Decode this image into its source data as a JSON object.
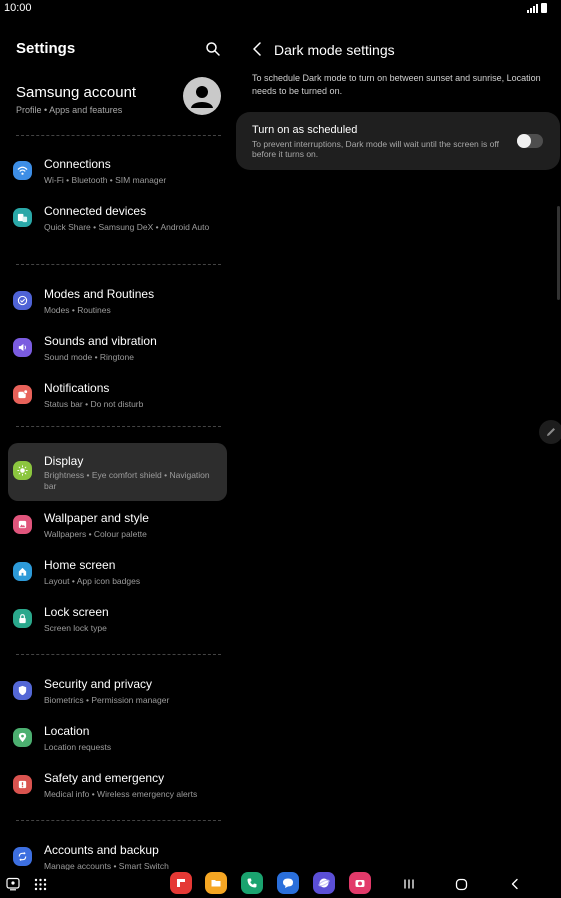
{
  "status": {
    "time": "10:00"
  },
  "left": {
    "title": "Settings",
    "account": {
      "name": "Samsung account",
      "sub": "Profile  •  Apps and features"
    },
    "items": [
      {
        "title": "Connections",
        "sub": "Wi-Fi  •  Bluetooth  •  SIM manager",
        "icon": "wifi-icon",
        "color": "#3d8ee6"
      },
      {
        "title": "Connected devices",
        "sub": "Quick Share  •  Samsung DeX  •  Android Auto",
        "icon": "connected-devices-icon",
        "color": "#2aa8a8"
      },
      {
        "title": "Modes and Routines",
        "sub": "Modes  •  Routines",
        "icon": "modes-routines-icon",
        "color": "#4f63d6"
      },
      {
        "title": "Sounds and vibration",
        "sub": "Sound mode  •  Ringtone",
        "icon": "speaker-icon",
        "color": "#7b5ce0"
      },
      {
        "title": "Notifications",
        "sub": "Status bar  •  Do not disturb",
        "icon": "notifications-icon",
        "color": "#e8625a"
      },
      {
        "title": "Display",
        "sub": "Brightness  •  Eye comfort shield  •  Navigation bar",
        "icon": "brightness-icon",
        "color": "#8cc63f"
      },
      {
        "title": "Wallpaper and style",
        "sub": "Wallpapers  •  Colour palette",
        "icon": "wallpaper-icon",
        "color": "#e0557c"
      },
      {
        "title": "Home screen",
        "sub": "Layout  •  App icon badges",
        "icon": "home-icon",
        "color": "#2d9ad8"
      },
      {
        "title": "Lock screen",
        "sub": "Screen lock type",
        "icon": "lock-icon",
        "color": "#2aa88c"
      },
      {
        "title": "Security and privacy",
        "sub": "Biometrics  •  Permission manager",
        "icon": "shield-icon",
        "color": "#5468d6"
      },
      {
        "title": "Location",
        "sub": "Location requests",
        "icon": "location-pin-icon",
        "color": "#4caf70"
      },
      {
        "title": "Safety and emergency",
        "sub": "Medical info  •  Wireless emergency alerts",
        "icon": "emergency-icon",
        "color": "#d9534f"
      },
      {
        "title": "Accounts and backup",
        "sub": "Manage accounts  •  Smart Switch",
        "icon": "sync-icon",
        "color": "#3d6fe0"
      }
    ],
    "active_item": "Display"
  },
  "right": {
    "title": "Dark mode settings",
    "info": "To schedule Dark mode to turn on between sunset and sunrise, Location needs to be turned on.",
    "card": {
      "title": "Turn on as scheduled",
      "sub": "To prevent interruptions, Dark mode will wait until the screen is off before it turns on.",
      "toggle_on": false
    }
  },
  "dock": [
    {
      "icon": "flipboard-icon",
      "color": "#e53935"
    },
    {
      "icon": "my-files-icon",
      "color": "#f5a623"
    },
    {
      "icon": "phone-icon",
      "color": "#1aa36f"
    },
    {
      "icon": "messages-icon",
      "color": "#2a6fdb"
    },
    {
      "icon": "internet-icon",
      "color": "#5b4fd6"
    },
    {
      "icon": "camera-icon",
      "color": "#e23a6a"
    }
  ]
}
